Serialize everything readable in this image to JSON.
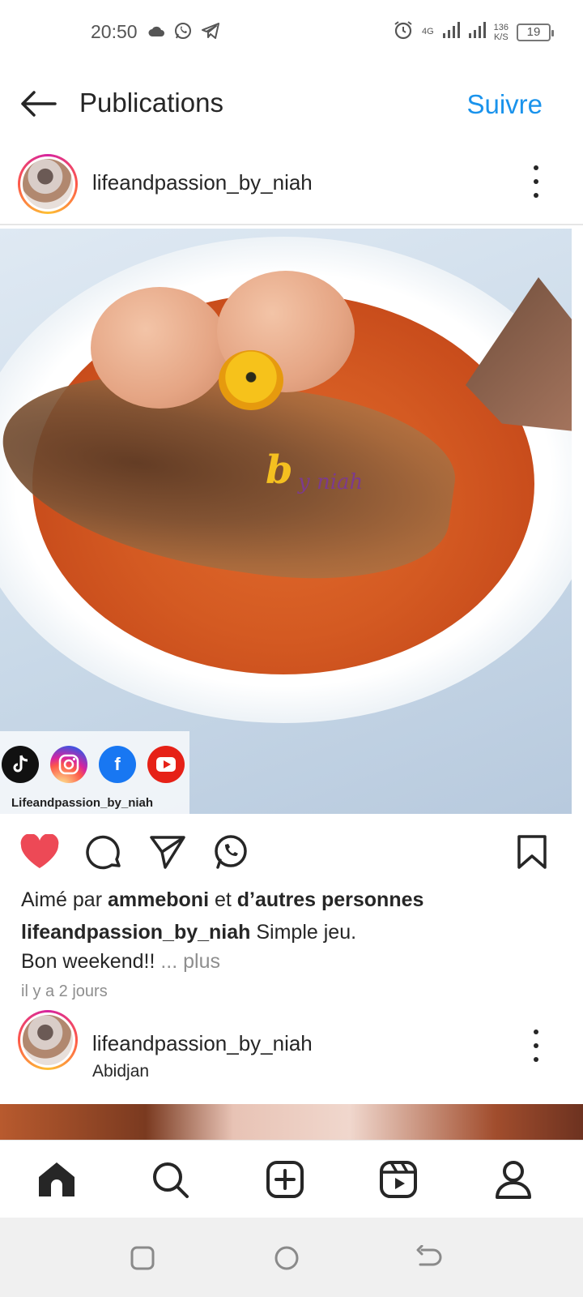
{
  "status_bar": {
    "time": "20:50",
    "network_4g": "4G",
    "speed_value": "136",
    "speed_unit": "K/S",
    "battery": "19"
  },
  "header": {
    "title": "Publications",
    "follow_label": "Suivre"
  },
  "post": {
    "username": "lifeandpassion_by_niah",
    "image": {
      "watermark_main": "b",
      "watermark_sub": "y niah",
      "social_handle": "Lifeandpassion_by_niah",
      "social_icons": [
        "tiktok-icon",
        "instagram-icon",
        "facebook-icon",
        "youtube-icon"
      ]
    },
    "likes_prefix": "Aimé par ",
    "likes_user": "ammeboni",
    "likes_middle": " et ",
    "likes_others": "d’autres personnes",
    "caption_user": "lifeandpassion_by_niah",
    "caption_text_1": " Simple jeu.",
    "caption_text_2": "Bon weekend!!",
    "more_label": " ... plus",
    "time_ago": "il y a 2 jours"
  },
  "next_post": {
    "username": "lifeandpassion_by_niah",
    "location": "Abidjan"
  },
  "colors": {
    "accent": "#1a93ec",
    "like": "#ed4956",
    "text": "#262626",
    "muted": "#8e8e8e"
  }
}
